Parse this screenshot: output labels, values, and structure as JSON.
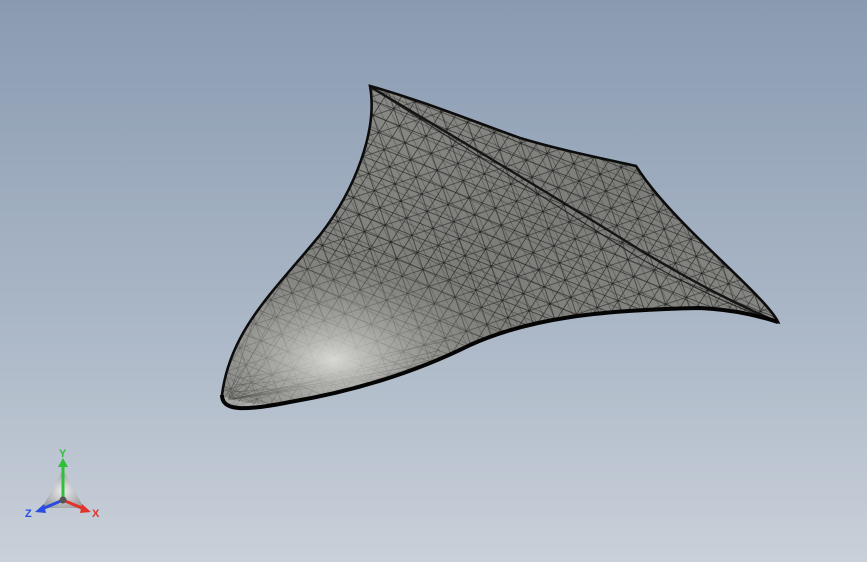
{
  "viewport": {
    "background_top": "#8a9bb1",
    "background_bottom": "#c9d0d9"
  },
  "model": {
    "display_style": "shaded-with-edges",
    "surface_color": "#7f7f7f",
    "edge_color": "#111111"
  },
  "triad": {
    "x_label": "X",
    "y_label": "Y",
    "z_label": "Z",
    "x_color": "#e0342a",
    "y_color": "#2fbf3a",
    "z_color": "#2a4de0"
  }
}
